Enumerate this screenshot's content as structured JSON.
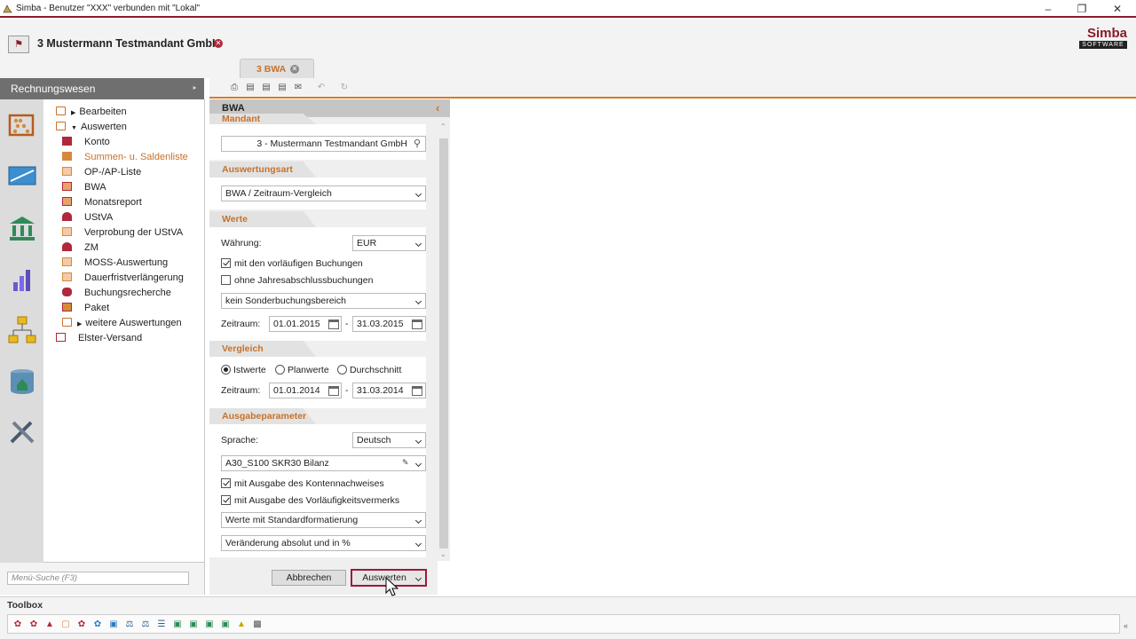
{
  "window": {
    "title": "Simba - Benutzer \"XXX\" verbunden mit \"Lokal\""
  },
  "company": {
    "name": "3 Mustermann Testmandant GmbH"
  },
  "logo": {
    "line1": "Simba",
    "line2": "SOFTWARE"
  },
  "tab": {
    "label": "3 BWA"
  },
  "nav": {
    "title": "Rechnungswesen",
    "items": [
      {
        "label": "Bearbeiten",
        "level": 0,
        "expanded": false
      },
      {
        "label": "Auswerten",
        "level": 0,
        "expanded": true
      },
      {
        "label": "Konto",
        "level": 1
      },
      {
        "label": "Summen- u. Saldenliste",
        "level": 1,
        "active": true
      },
      {
        "label": "OP-/AP-Liste",
        "level": 1
      },
      {
        "label": "BWA",
        "level": 1
      },
      {
        "label": "Monatsreport",
        "level": 1
      },
      {
        "label": "UStVA",
        "level": 1
      },
      {
        "label": "Verprobung der UStVA",
        "level": 1
      },
      {
        "label": "ZM",
        "level": 1
      },
      {
        "label": "MOSS-Auswertung",
        "level": 1
      },
      {
        "label": "Dauerfristverlängerung",
        "level": 1
      },
      {
        "label": "Buchungsrecherche",
        "level": 1
      },
      {
        "label": "Paket",
        "level": 1
      },
      {
        "label": "weitere Auswertungen",
        "level": 1,
        "folder": true
      },
      {
        "label": "Elster-Versand",
        "level": 0
      }
    ],
    "search_placeholder": "Menü-Suche (F3)"
  },
  "panel": {
    "title": "BWA",
    "mandant": {
      "title": "Mandant",
      "value": "3 - Mustermann Testmandant GmbH"
    },
    "auswertungsart": {
      "title": "Auswertungsart",
      "value": "BWA / Zeitraum-Vergleich"
    },
    "werte": {
      "title": "Werte",
      "currency_label": "Währung:",
      "currency": "EUR",
      "cb1": "mit den vorläufigen Buchungen",
      "cb1_checked": true,
      "cb2": "ohne Jahresabschlussbuchungen",
      "cb2_checked": false,
      "sonder": "kein Sonderbuchungsbereich",
      "period_label": "Zeitraum:",
      "from": "01.01.2015",
      "to": "31.03.2015",
      "sep": "-"
    },
    "vergleich": {
      "title": "Vergleich",
      "r1": "Istwerte",
      "r2": "Planwerte",
      "r3": "Durchschnitt",
      "selected": "Istwerte",
      "period_label": "Zeitraum:",
      "from": "01.01.2014",
      "to": "31.03.2014",
      "sep": "-"
    },
    "ausgabe": {
      "title": "Ausgabeparameter",
      "lang_label": "Sprache:",
      "lang": "Deutsch",
      "layout": "A30_S100  SKR30 Bilanz",
      "cb1": "mit Ausgabe des Kontennachweises",
      "cb1_checked": true,
      "cb2": "mit Ausgabe des Vorläufigkeitsvermerks",
      "cb2_checked": true,
      "format": "Werte mit Standardformatierung",
      "change": "Veränderung absolut und in %"
    },
    "cancel": "Abbrechen",
    "run": "Auswerten"
  },
  "toolbox": {
    "title": "Toolbox"
  },
  "colors": {
    "brand": "#8b1a2b",
    "accent": "#c7722a"
  }
}
